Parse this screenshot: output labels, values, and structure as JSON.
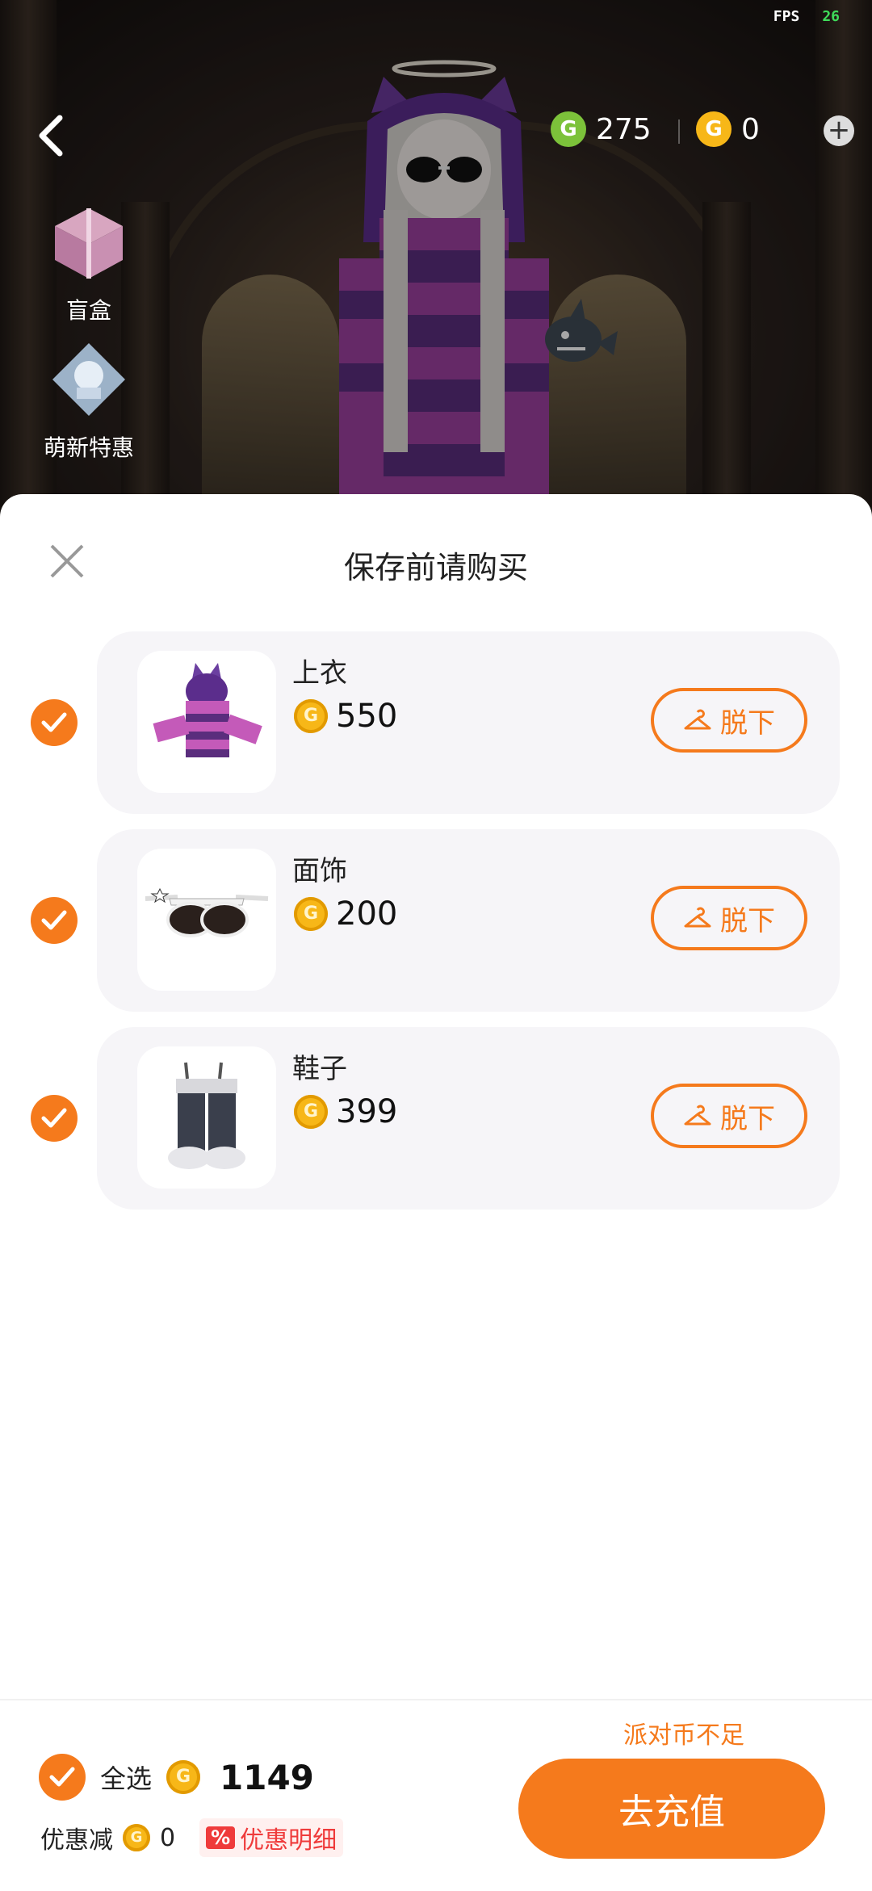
{
  "status": {
    "fps_label": "FPS",
    "fps_value": "26"
  },
  "header": {
    "green_currency": "275",
    "gold_currency": "0",
    "green_color": "#7cc23a",
    "gold_color": "#f7b718"
  },
  "sidebar": {
    "items": [
      {
        "label": "盲盒",
        "icon": "gift-box-icon"
      },
      {
        "label": "萌新特惠",
        "icon": "novice-offer-icon"
      }
    ]
  },
  "sheet": {
    "title": "保存前请购买",
    "remove_label": "脱下",
    "items": [
      {
        "name": "上衣",
        "price": "550",
        "checked": true,
        "thumb": "striped-hoodie-thumb"
      },
      {
        "name": "面饰",
        "price": "200",
        "checked": true,
        "thumb": "sunglasses-thumb"
      },
      {
        "name": "鞋子",
        "price": "399",
        "checked": true,
        "thumb": "boots-thumb"
      }
    ]
  },
  "footer": {
    "insufficient": "派对币不足",
    "select_all_label": "全选",
    "total": "1149",
    "discount_label": "优惠减",
    "discount_value": "0",
    "discount_badge": "%",
    "detail_label": "优惠明细",
    "recharge_label": "去充值",
    "accent_color": "#f57a1c"
  }
}
